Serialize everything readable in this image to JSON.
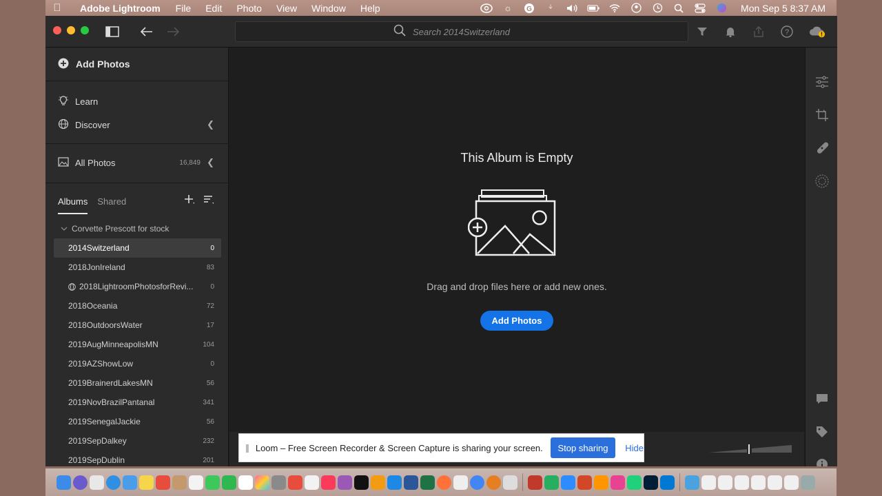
{
  "menubar": {
    "app_name": "Adobe Lightroom",
    "menus": [
      "File",
      "Edit",
      "Photo",
      "View",
      "Window",
      "Help"
    ],
    "clock": "Mon Sep 5  8:37 AM"
  },
  "toolbar": {
    "search_placeholder": "Search 2014Switzerland"
  },
  "sidebar": {
    "add_photos": "Add Photos",
    "learn": "Learn",
    "discover": "Discover",
    "all_photos": "All Photos",
    "all_photos_count": "16,849",
    "tabs": {
      "albums": "Albums",
      "shared": "Shared"
    },
    "folder": "Corvette Prescott for stock",
    "albums": [
      {
        "name": "2014Switzerland",
        "count": "0",
        "selected": true
      },
      {
        "name": "2018JonIreland",
        "count": "83"
      },
      {
        "name": "2018LightroomPhotosforRevi...",
        "count": "0",
        "shared": true
      },
      {
        "name": "2018Oceania",
        "count": "72"
      },
      {
        "name": "2018OutdoorsWater",
        "count": "17"
      },
      {
        "name": "2019AugMinneapolisMN",
        "count": "104"
      },
      {
        "name": "2019AZShowLow",
        "count": "0"
      },
      {
        "name": "2019BrainerdLakesMN",
        "count": "56"
      },
      {
        "name": "2019NovBrazilPantanal",
        "count": "341"
      },
      {
        "name": "2019SenegalJackie",
        "count": "56"
      },
      {
        "name": "2019SepDalkey",
        "count": "232"
      },
      {
        "name": "2019SepDublin",
        "count": "201"
      }
    ]
  },
  "main": {
    "empty_title": "This Album is Empty",
    "empty_text": "Drag and drop files here or add new ones.",
    "add_button": "Add Photos"
  },
  "loom": {
    "message": "Loom – Free Screen Recorder & Screen Capture is sharing your screen.",
    "stop_label": "Stop sharing",
    "hide_label": "Hide"
  },
  "colors": {
    "accent": "#1473e6",
    "panel": "#2b2b2b",
    "background": "#1e1e1e"
  }
}
